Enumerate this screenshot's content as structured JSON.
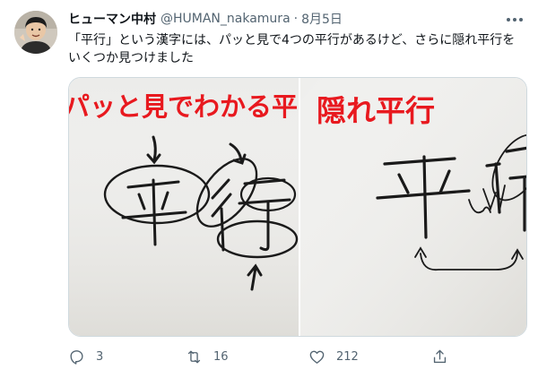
{
  "tweet": {
    "display_name": "ヒューマン中村",
    "handle": "@HUMAN_nakamura",
    "separator": "·",
    "date": "8月5日",
    "text": "「平行」という漢字には、パッと見で4つの平行があるけど、さらに隠れ平行をいくつか見つけました"
  },
  "media": {
    "left_caption": "パッと見でわかる平",
    "right_caption": "隠れ平行",
    "caption_color": "#e8191f"
  },
  "actions": {
    "reply_count": "3",
    "retweet_count": "16",
    "like_count": "212"
  },
  "icons": [
    "more-icon",
    "reply-icon",
    "retweet-icon",
    "like-icon",
    "share-icon"
  ]
}
